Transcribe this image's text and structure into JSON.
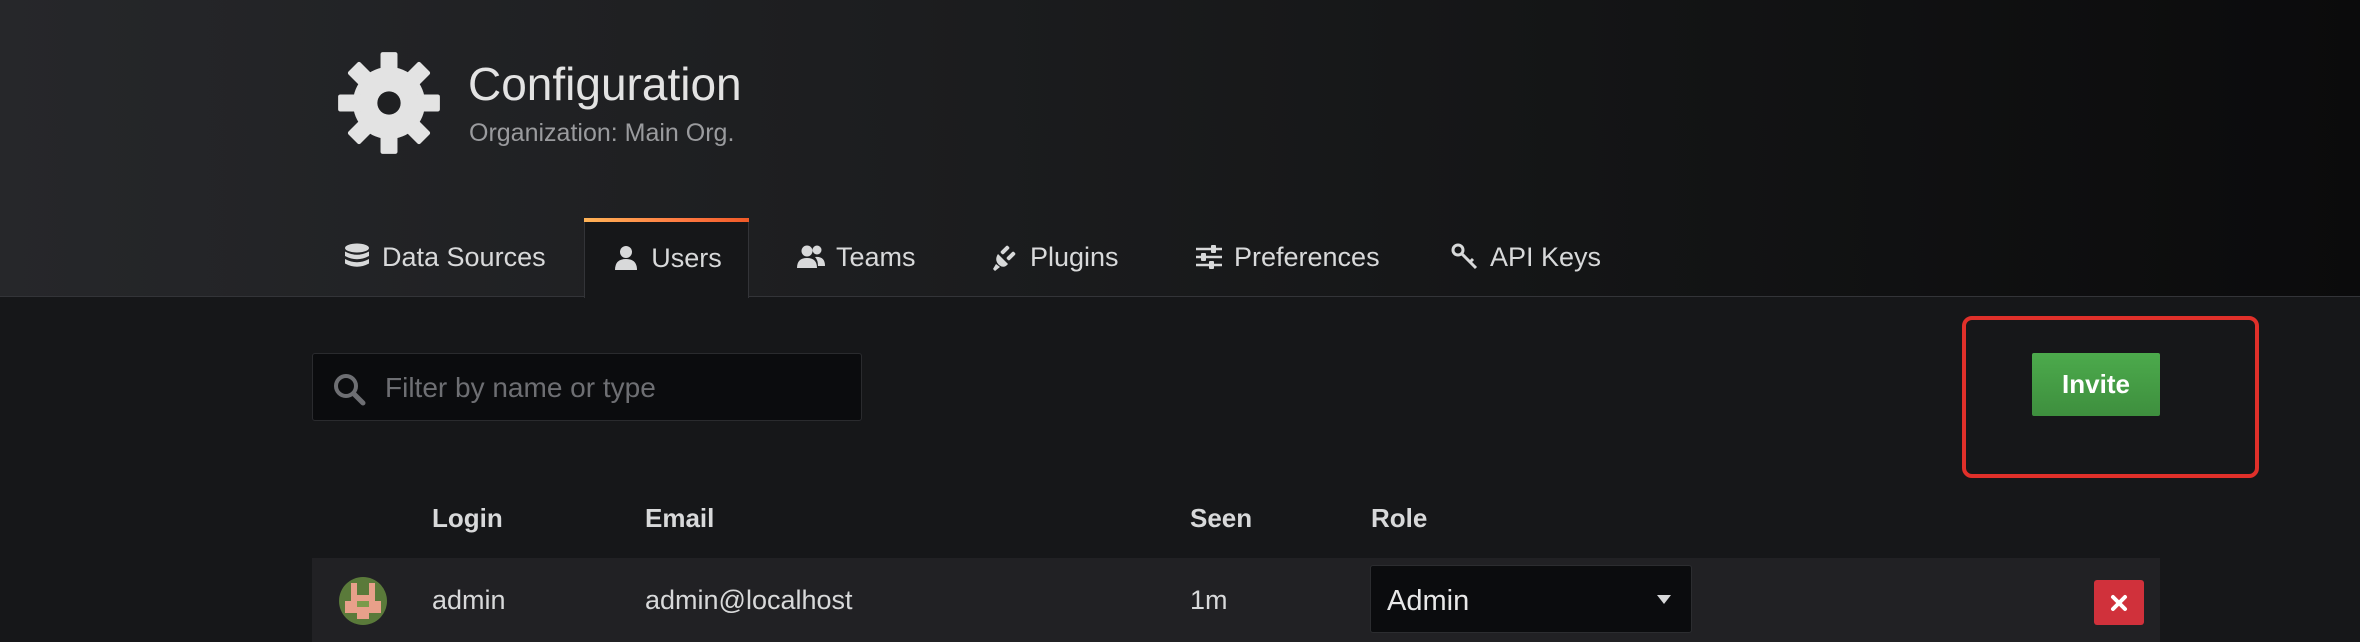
{
  "header": {
    "title": "Configuration",
    "subtitle": "Organization: Main Org.",
    "icon": "gear-icon"
  },
  "tabs": [
    {
      "label": "Data Sources",
      "icon": "database-icon",
      "active": false
    },
    {
      "label": "Users",
      "icon": "user-icon",
      "active": true
    },
    {
      "label": "Teams",
      "icon": "users-icon",
      "active": false
    },
    {
      "label": "Plugins",
      "icon": "plug-icon",
      "active": false
    },
    {
      "label": "Preferences",
      "icon": "sliders-icon",
      "active": false
    },
    {
      "label": "API Keys",
      "icon": "key-icon",
      "active": false
    }
  ],
  "search": {
    "placeholder": "Filter by name or type",
    "value": ""
  },
  "toolbar": {
    "invite_label": "Invite"
  },
  "table": {
    "columns": [
      "Login",
      "Email",
      "Seen",
      "Role"
    ],
    "rows": [
      {
        "login": "admin",
        "email": "admin@localhost",
        "seen": "1m",
        "role": "Admin"
      }
    ]
  },
  "colors": {
    "invite_green": "#3e8f3e",
    "delete_red": "#d0313b",
    "highlight_red": "#e0302a",
    "tab_accent": "#ff7941"
  }
}
